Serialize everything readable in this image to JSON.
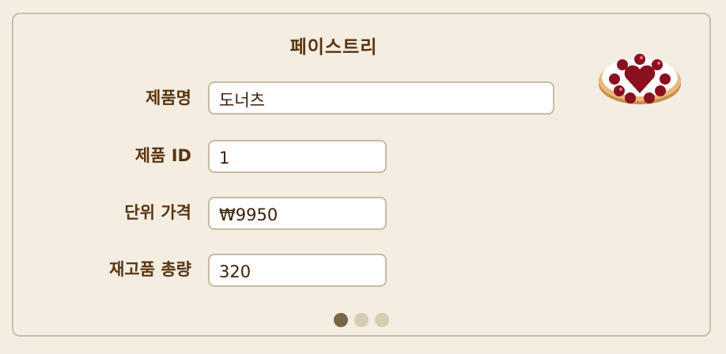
{
  "card": {
    "title": "페이스트리",
    "image_icon": "cherry-tart-icon"
  },
  "fields": {
    "product_name": {
      "label": "제품명",
      "value": "도너츠"
    },
    "product_id": {
      "label": "제품 ID",
      "value": "1"
    },
    "unit_price": {
      "label": "단위 가격",
      "value": "₩9950"
    },
    "stock_total": {
      "label": "재고품 총량",
      "value": "320"
    }
  },
  "pager": {
    "page_count": 3,
    "active_page": 1
  },
  "colors": {
    "background": "#f3ede2",
    "border": "#cbbfa8",
    "label_text": "#5a3410",
    "dot_active": "#7a6646",
    "dot_inactive": "#d6ccb0"
  }
}
